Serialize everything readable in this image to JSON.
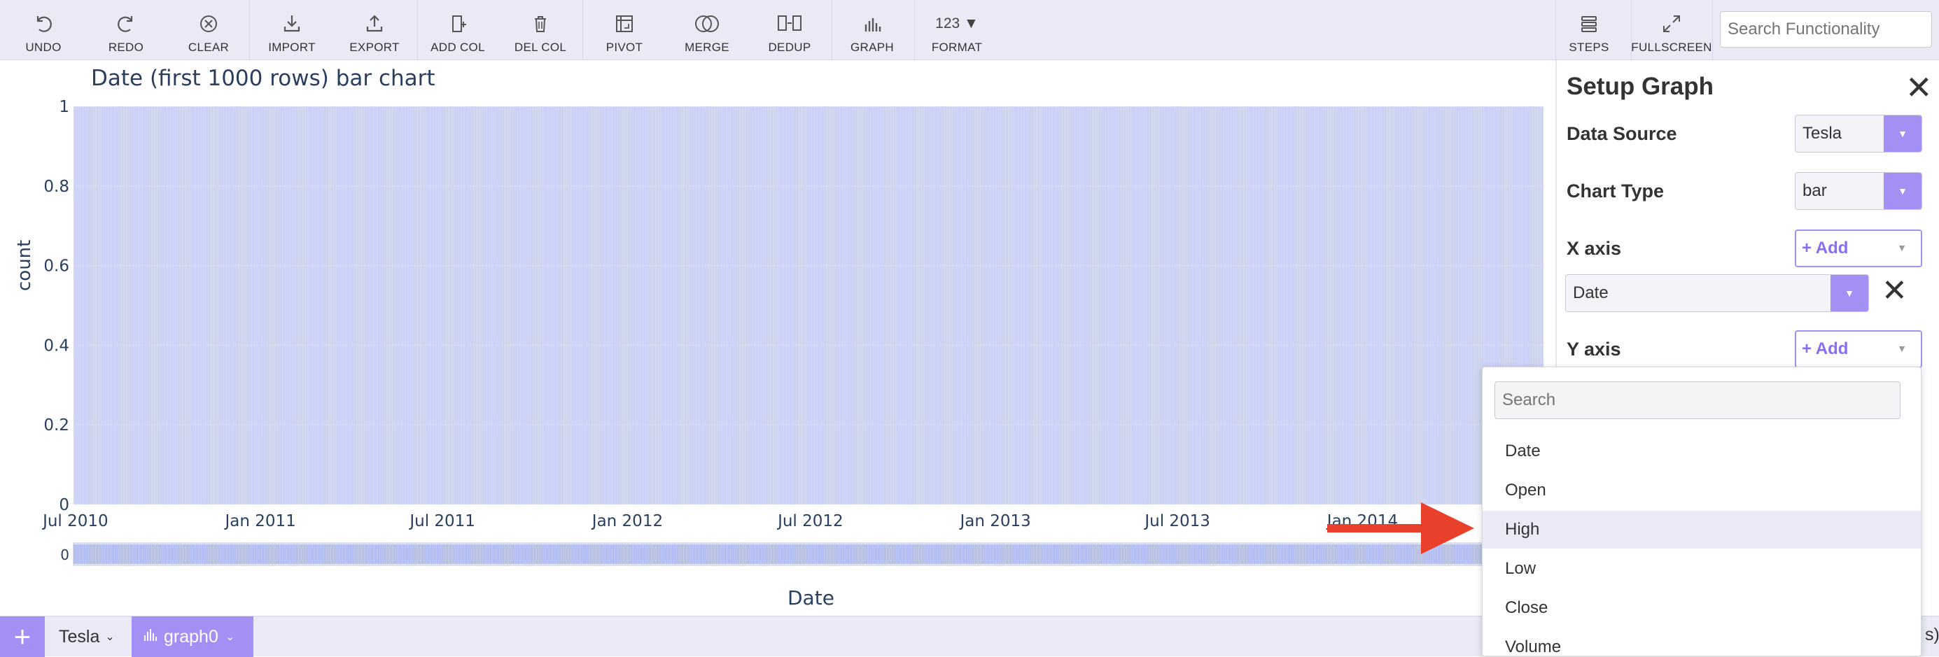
{
  "toolbar": {
    "buttons": [
      {
        "label": "UNDO",
        "icon": "undo-icon"
      },
      {
        "label": "REDO",
        "icon": "redo-icon"
      },
      {
        "label": "CLEAR",
        "icon": "clear-icon"
      },
      {
        "label": "IMPORT",
        "icon": "import-icon"
      },
      {
        "label": "EXPORT",
        "icon": "export-icon"
      },
      {
        "label": "ADD COL",
        "icon": "add-column-icon"
      },
      {
        "label": "DEL COL",
        "icon": "delete-column-icon"
      },
      {
        "label": "PIVOT",
        "icon": "pivot-icon"
      },
      {
        "label": "MERGE",
        "icon": "merge-icon"
      },
      {
        "label": "DEDUP",
        "icon": "dedup-icon"
      },
      {
        "label": "GRAPH",
        "icon": "graph-icon"
      },
      {
        "label": "FORMAT",
        "icon": "format-icon",
        "icon_text": "123 ▼"
      },
      {
        "label": "STEPS",
        "icon": "steps-icon"
      },
      {
        "label": "FULLSCREEN",
        "icon": "fullscreen-icon"
      }
    ],
    "search_placeholder": "Search Functionality"
  },
  "chart_data": {
    "type": "bar",
    "title": "Date (first 1000 rows) bar chart",
    "xlabel": "Date",
    "ylabel": "count",
    "x_range": [
      "2010-06-29",
      "2014-06-30"
    ],
    "ylim": [
      0,
      1
    ],
    "y_ticks": [
      "0",
      "0.2",
      "0.4",
      "0.6",
      "0.8",
      "1"
    ],
    "x_ticks": [
      "Jul 2010",
      "Jan 2011",
      "Jul 2011",
      "Jan 2012",
      "Jul 2012",
      "Jan 2013",
      "Jul 2013",
      "Jan 2014"
    ],
    "bar_value": 1,
    "bar_count": 1000,
    "range_slider_label": "0",
    "grid": true,
    "bar_color": "#c5cbf4",
    "bar_edge_color": "#a7b1ee",
    "plot_bg": "#e5ecf6"
  },
  "panel": {
    "title": "Setup Graph",
    "data_source_label": "Data Source",
    "data_source_value": "Tesla",
    "chart_type_label": "Chart Type",
    "chart_type_value": "bar",
    "x_axis_label": "X axis",
    "x_axis_add": "+ Add",
    "x_axis_selected": "Date",
    "y_axis_label": "Y axis",
    "y_axis_add": "+ Add"
  },
  "dropdown": {
    "search_placeholder": "Search",
    "options": [
      "Date",
      "Open",
      "High",
      "Low",
      "Close",
      "Volume"
    ],
    "highlighted": "High"
  },
  "bottombar": {
    "plus": "+",
    "sheet_tab": "Tesla",
    "graph_tab": "graph0",
    "right_fragment": "s)"
  },
  "colors": {
    "accent": "#a48ff5",
    "toolbar_bg": "#e9eaf6",
    "arrow": "#e8402b"
  }
}
